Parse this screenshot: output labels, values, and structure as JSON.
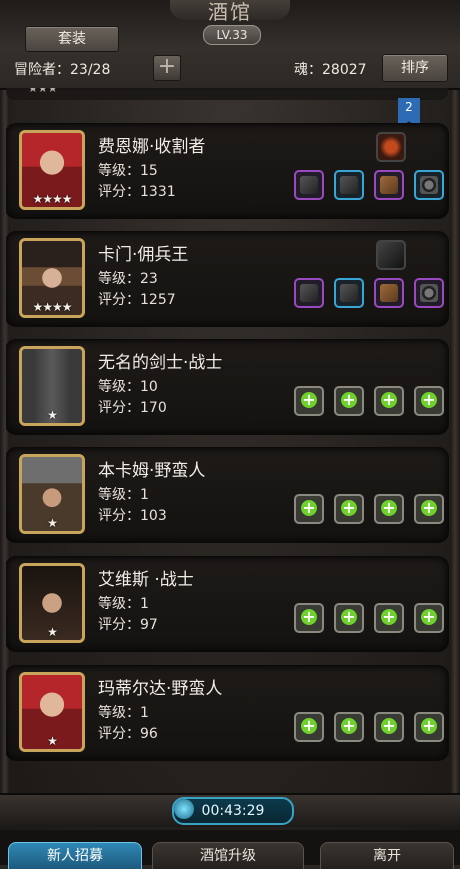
{
  "header": {
    "title": "酒馆",
    "set_label": "套装",
    "tavern_level": "LV.33",
    "adventurers": "冒险者：23/28",
    "plus_label": "+",
    "soul": "魂：28027",
    "sort_label": "排序"
  },
  "list": {
    "partial_stars": "★★★",
    "ribbon_number": "2",
    "heroes": [
      {
        "name": "费恩娜·收割者",
        "level": "等级：15",
        "score": "评分：1331",
        "stars": "★★★★",
        "portrait": "red-haired-woman",
        "equipment": [
          "epic",
          "rare",
          "epic",
          "rare"
        ],
        "top_item": true
      },
      {
        "name": "卡门·佣兵王",
        "level": "等级：23",
        "score": "评分：1257",
        "stars": "★★★★",
        "portrait": "hat-woman",
        "equipment": [
          "epic",
          "rare",
          "epic",
          "epic"
        ],
        "top_item": true
      },
      {
        "name": "无名的剑士·战士",
        "level": "等级：10",
        "score": "评分：170",
        "stars": "★",
        "portrait": "helmet-knight",
        "equipment": [
          "empty",
          "empty",
          "empty",
          "empty"
        ],
        "top_item": false
      },
      {
        "name": "本卡姆·野蛮人",
        "level": "等级：1",
        "score": "评分：103",
        "stars": "★",
        "portrait": "dwarf-helmet",
        "equipment": [
          "empty",
          "empty",
          "empty",
          "empty"
        ],
        "top_item": false
      },
      {
        "name": "艾维斯 ·战士",
        "level": "等级：1",
        "score": "评分：97",
        "stars": "★",
        "portrait": "dark-haired-man",
        "equipment": [
          "empty",
          "empty",
          "empty",
          "empty"
        ],
        "top_item": false
      },
      {
        "name": "玛蒂尔达·野蛮人",
        "level": "等级：1",
        "score": "评分：96",
        "stars": "★",
        "portrait": "red-haired-woman",
        "equipment": [
          "empty",
          "empty",
          "empty",
          "empty"
        ],
        "top_item": false
      }
    ]
  },
  "footer": {
    "timer": "00:43:29",
    "tabs": [
      "新人招募",
      "酒馆升级",
      "离开"
    ]
  },
  "colors": {
    "epic": "#9b49c0",
    "rare": "#3aa6d6",
    "plus_green": "#6ed12c",
    "gold_frame": "#c9a55b",
    "timer_blue": "#3aa3c4"
  }
}
